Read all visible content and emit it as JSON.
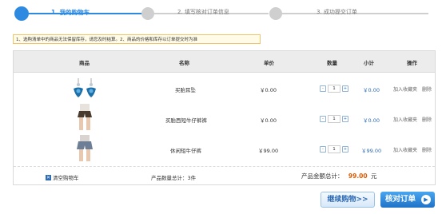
{
  "steps": [
    {
      "label": "1. 我的购物车",
      "active": true
    },
    {
      "label": "2. 填写核对订单信息",
      "active": false
    },
    {
      "label": "3. 成功提交订单",
      "active": false
    }
  ],
  "notice": "1、选购清单中的商品无法保留库存，请您及时结算。2、商品的价格和库存以订单提交时为准",
  "table": {
    "headers": {
      "product": "商品",
      "name": "名称",
      "price": "单价",
      "qty": "数量",
      "subtotal": "小计",
      "ops": "操作"
    },
    "rows": [
      {
        "name": "买胎耳坠",
        "price": "￥0.00",
        "qty": "1",
        "subtotal": "￥0.00",
        "fav": "加入收藏夹",
        "del": "删除",
        "image": "earring-image"
      },
      {
        "name": "买胎西短牛仔裤裤",
        "price": "￥0.00",
        "qty": "1",
        "subtotal": "￥0.00",
        "fav": "加入收藏夹",
        "del": "删除",
        "image": "shorts-image"
      },
      {
        "name": "休闲短牛仔裤",
        "price": "￥99.00",
        "qty": "1",
        "subtotal": "￥99.00",
        "fav": "加入收藏夹",
        "del": "删除",
        "image": "denim-shorts-image"
      }
    ],
    "qty_minus": "-",
    "qty_plus": "+"
  },
  "footer": {
    "clear_icon": "x-icon",
    "clear_label": "清空购物车",
    "count_label": "产品数量总计：3件",
    "total_label": "产品金额总计：",
    "total_value": "99.00",
    "total_unit": "元"
  },
  "buttons": {
    "continue": "继续购物>>",
    "checkout": "核对订单"
  },
  "colors": {
    "accent": "#2d8ae0",
    "total": "#e05a00"
  }
}
